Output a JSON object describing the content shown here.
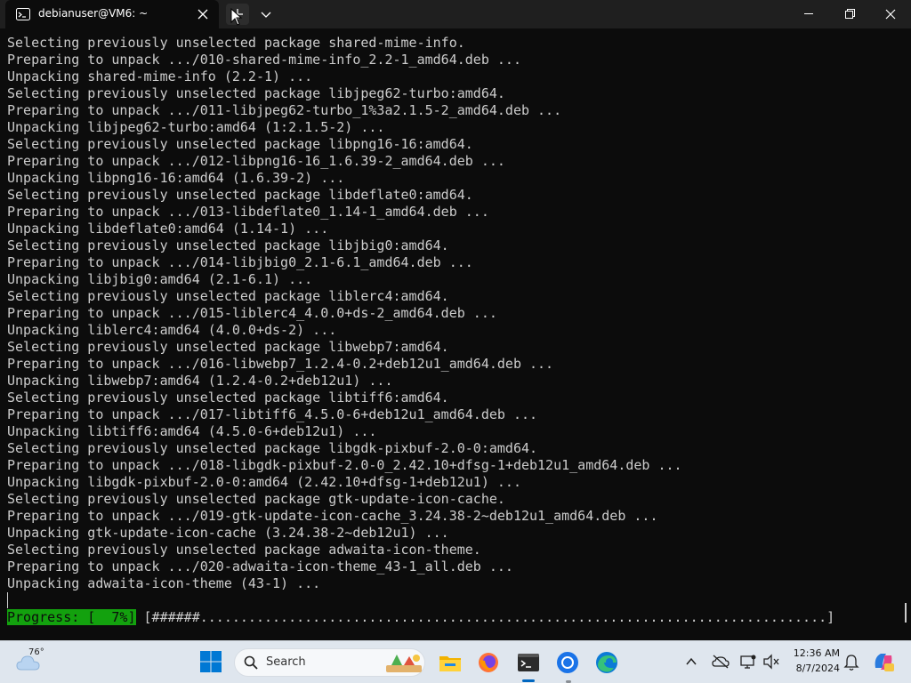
{
  "window": {
    "tab_title": "debianuser@VM6: ~"
  },
  "terminal": {
    "lines": [
      "Selecting previously unselected package shared-mime-info.",
      "Preparing to unpack .../010-shared-mime-info_2.2-1_amd64.deb ...",
      "Unpacking shared-mime-info (2.2-1) ...",
      "Selecting previously unselected package libjpeg62-turbo:amd64.",
      "Preparing to unpack .../011-libjpeg62-turbo_1%3a2.1.5-2_amd64.deb ...",
      "Unpacking libjpeg62-turbo:amd64 (1:2.1.5-2) ...",
      "Selecting previously unselected package libpng16-16:amd64.",
      "Preparing to unpack .../012-libpng16-16_1.6.39-2_amd64.deb ...",
      "Unpacking libpng16-16:amd64 (1.6.39-2) ...",
      "Selecting previously unselected package libdeflate0:amd64.",
      "Preparing to unpack .../013-libdeflate0_1.14-1_amd64.deb ...",
      "Unpacking libdeflate0:amd64 (1.14-1) ...",
      "Selecting previously unselected package libjbig0:amd64.",
      "Preparing to unpack .../014-libjbig0_2.1-6.1_amd64.deb ...",
      "Unpacking libjbig0:amd64 (2.1-6.1) ...",
      "Selecting previously unselected package liblerc4:amd64.",
      "Preparing to unpack .../015-liblerc4_4.0.0+ds-2_amd64.deb ...",
      "Unpacking liblerc4:amd64 (4.0.0+ds-2) ...",
      "Selecting previously unselected package libwebp7:amd64.",
      "Preparing to unpack .../016-libwebp7_1.2.4-0.2+deb12u1_amd64.deb ...",
      "Unpacking libwebp7:amd64 (1.2.4-0.2+deb12u1) ...",
      "Selecting previously unselected package libtiff6:amd64.",
      "Preparing to unpack .../017-libtiff6_4.5.0-6+deb12u1_amd64.deb ...",
      "Unpacking libtiff6:amd64 (4.5.0-6+deb12u1) ...",
      "Selecting previously unselected package libgdk-pixbuf-2.0-0:amd64.",
      "Preparing to unpack .../018-libgdk-pixbuf-2.0-0_2.42.10+dfsg-1+deb12u1_amd64.deb ...",
      "Unpacking libgdk-pixbuf-2.0-0:amd64 (2.42.10+dfsg-1+deb12u1) ...",
      "Selecting previously unselected package gtk-update-icon-cache.",
      "Preparing to unpack .../019-gtk-update-icon-cache_3.24.38-2~deb12u1_amd64.deb ...",
      "Unpacking gtk-update-icon-cache (3.24.38-2~deb12u1) ...",
      "Selecting previously unselected package adwaita-icon-theme.",
      "Preparing to unpack .../020-adwaita-icon-theme_43-1_all.deb ...",
      "Unpacking adwaita-icon-theme (43-1) ..."
    ],
    "progress_label": "Progress: [  7%]",
    "progress_bar": "[######..............................................................................]",
    "progress_percent": 7
  },
  "taskbar": {
    "weather_temp": "76°",
    "search_placeholder": "Search",
    "clock_time": "12:36 AM",
    "clock_date": "8/7/2024"
  },
  "colors": {
    "terminal_bg": "#0c0c0c",
    "terminal_fg": "#cccccc",
    "progress_green": "#13a10e",
    "taskbar_bg": "#dfe6ee",
    "accent": "#0067c0"
  }
}
